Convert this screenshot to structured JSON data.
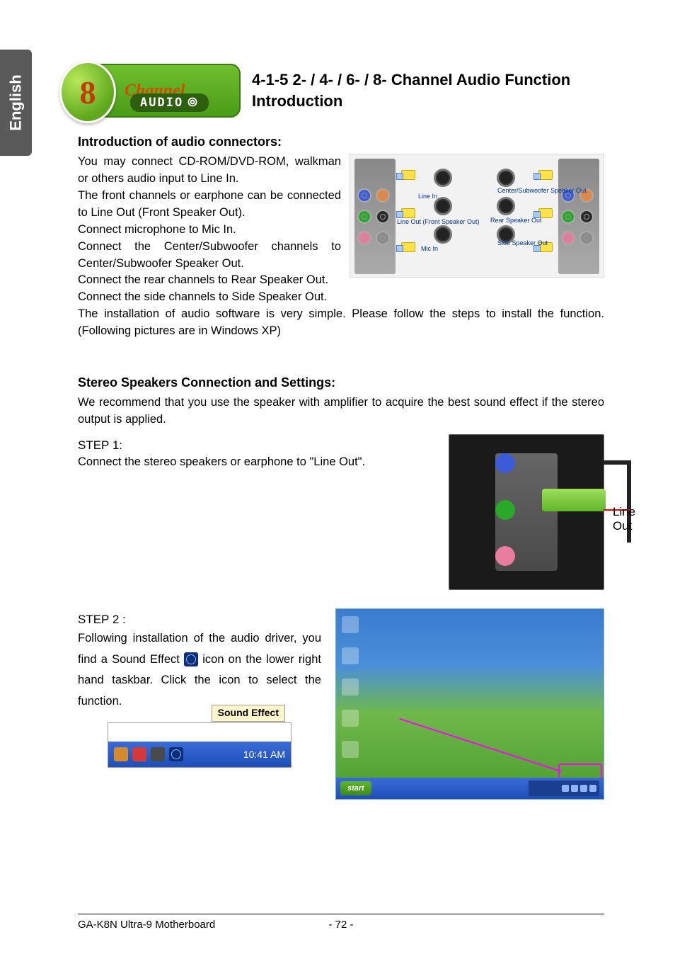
{
  "sideTab": "English",
  "logo": {
    "digit": "8",
    "channel": "Channel",
    "audio": "AUDIO"
  },
  "headerTitle": "4-1-5   2- / 4- / 6- / 8- Channel Audio Function Introduction",
  "introHeading": "Introduction of audio connectors:",
  "introLines": [
    "You may connect CD-ROM/DVD-ROM, walkman or others audio input to Line In.",
    "The front channels or earphone can be connected to Line Out (Front Speaker Out).",
    "Connect microphone to Mic In.",
    "Connect the Center/Subwoofer channels to Center/Subwoofer Speaker Out.",
    "Connect the rear channels to Rear Speaker Out.",
    "Connect the side channels to Side Speaker Out."
  ],
  "introTail": "The installation of audio software is very simple. Please follow the steps to install the function. (Following pictures are in Windows XP)",
  "diagramLabels": {
    "lineIn": "Line In",
    "lineOut": "Line Out (Front Speaker Out)",
    "micIn": "Mic In",
    "centerSub": "Center/Subwoofer Speaker Out",
    "rearOut": "Rear Speaker Out",
    "sideOut": "Side Speaker Out"
  },
  "stereoHeading": "Stereo Speakers Connection and Settings:",
  "stereoIntro": "We recommend that you use the speaker with amplifier to acquire the best sound effect if the stereo output is applied.",
  "step1Label": "STEP 1:",
  "step1Text": "Connect the stereo speakers or earphone to \"Line Out\".",
  "lineOutLabel": "Line Out",
  "step2Label": "STEP 2 :",
  "step2TextA": "Following installation of the audio driver, you find a Sound Effect ",
  "step2TextB": " icon on the lower right hand taskbar.  Click the icon to select the function.",
  "tooltip": "Sound Effect",
  "trayTime": "10:41 AM",
  "startBtn": "start",
  "footer": {
    "model": "GA-K8N Ultra-9 Motherboard",
    "page": "- 72 -"
  }
}
